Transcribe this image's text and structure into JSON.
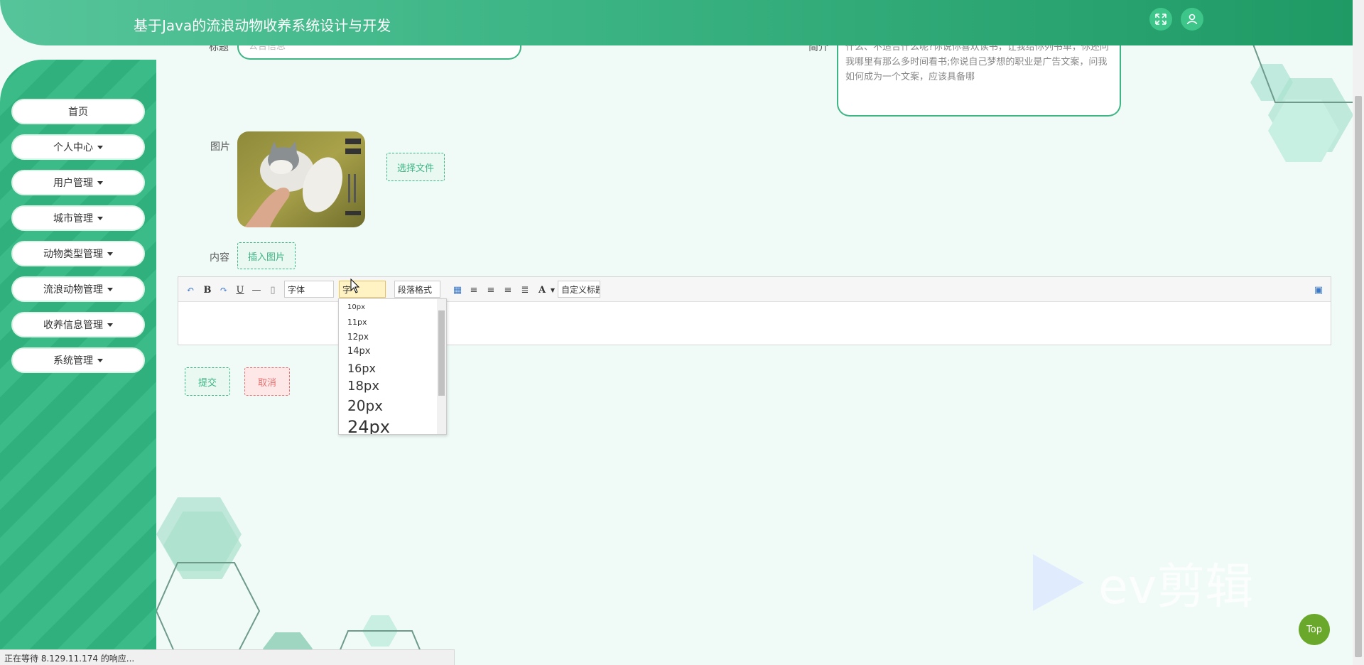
{
  "header": {
    "title": "基于Java的流浪动物收养系统设计与开发",
    "fullscreen_icon": "expand-icon",
    "user_icon": "user-icon"
  },
  "sidebar": {
    "items": [
      {
        "label": "首页",
        "has_caret": false
      },
      {
        "label": "个人中心",
        "has_caret": true
      },
      {
        "label": "用户管理",
        "has_caret": true
      },
      {
        "label": "城市管理",
        "has_caret": true
      },
      {
        "label": "动物类型管理",
        "has_caret": true
      },
      {
        "label": "流浪动物管理",
        "has_caret": true
      },
      {
        "label": "收养信息管理",
        "has_caret": true
      },
      {
        "label": "系统管理",
        "has_caret": true
      }
    ]
  },
  "form": {
    "title_label": "标题",
    "title_placeholder": "公告信息",
    "intro_label": "简介",
    "intro_text": "什么、不适合什么呢?你说你喜欢读书，让我给你列书单，你还问我哪里有那么多时间看书;你说自己梦想的职业是广告文案，问我如何成为一个文案，应该具备哪",
    "image_label": "图片",
    "choose_file_label": "选择文件",
    "content_label": "内容",
    "insert_image_label": "插入图片",
    "submit_label": "提交",
    "cancel_label": "取消"
  },
  "editor": {
    "font_select": "字体",
    "size_select": "字",
    "paragraph_select": "段落格式",
    "custom_select": "自定义标题",
    "font_size_options": [
      "10px",
      "11px",
      "12px",
      "14px",
      "16px",
      "18px",
      "20px",
      "24px"
    ]
  },
  "top_button_label": "Top",
  "watermark_text": "ev剪辑",
  "statusbar_text": "正在等待 8.129.11.174 的响应..."
}
